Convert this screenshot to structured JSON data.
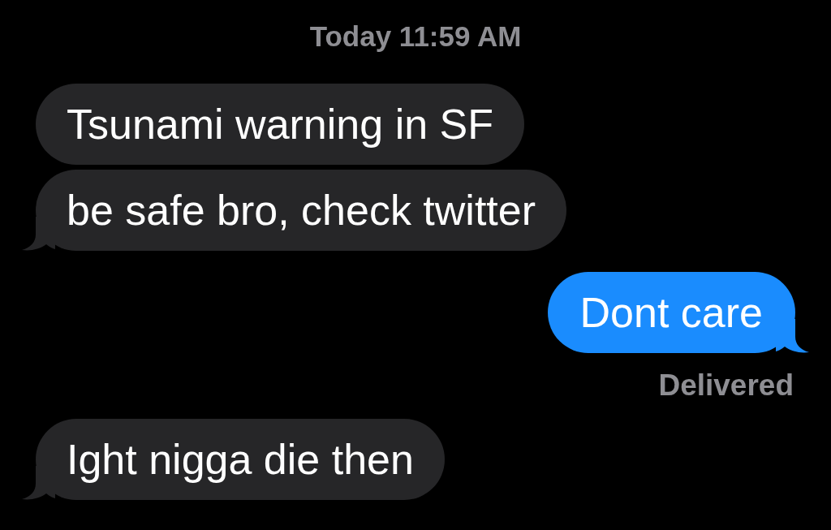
{
  "timestamp": "Today 11:59 AM",
  "messages": [
    {
      "kind": "received",
      "text": "Tsunami warning in SF"
    },
    {
      "kind": "received",
      "text": "be safe bro, check twitter"
    },
    {
      "kind": "sent",
      "text": "Dont care"
    },
    {
      "kind": "status",
      "text": "Delivered"
    },
    {
      "kind": "received",
      "text": "Ight nigga die then"
    }
  ]
}
